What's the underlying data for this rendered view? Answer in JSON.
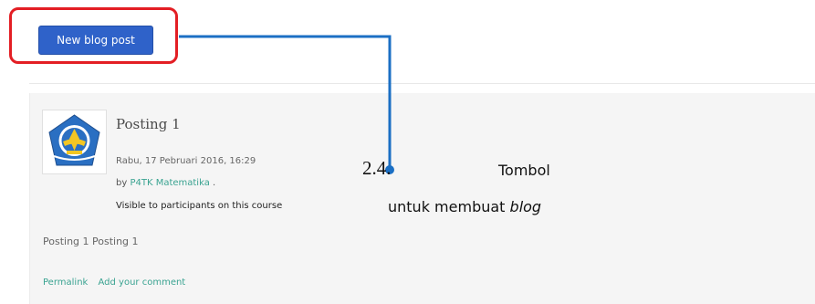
{
  "toolbar": {
    "new_post_label": "New blog post"
  },
  "post": {
    "subject": "Posting 1",
    "date": "Rabu, 17 Pebruari 2016, 16:29",
    "by_prefix": "by",
    "author": "P4TK Matematika",
    "author_suffix": ".",
    "visibility": "Visible to participants on this course",
    "body": "Posting 1 Posting 1",
    "permalink_label": "Permalink",
    "comment_label": "Add your comment"
  },
  "annotation": {
    "number": "2.4.",
    "title": "Tombol",
    "desc_prefix": "untuk membuat",
    "desc_italic": "blog"
  },
  "colors": {
    "button": "#2f62c9",
    "highlight": "#e31e24",
    "connector": "#1b6fc4",
    "link": "#3aa391"
  },
  "icons": {
    "avatar": "tut-wuri-handayani-logo"
  }
}
